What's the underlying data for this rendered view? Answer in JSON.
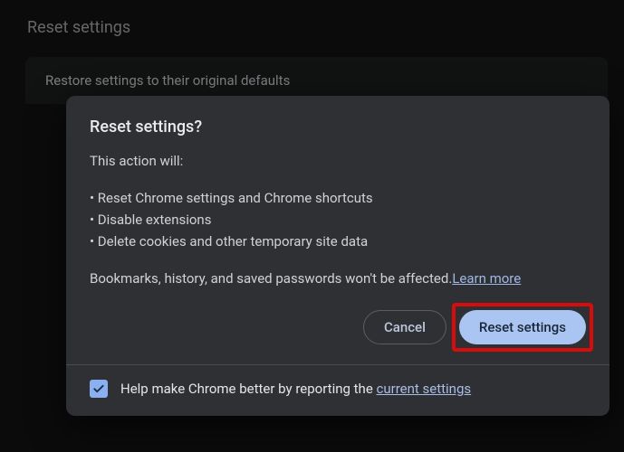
{
  "page": {
    "title": "Reset settings",
    "row_label": "Restore settings to their original defaults"
  },
  "dialog": {
    "title": "Reset settings?",
    "intro": "This action will:",
    "bullets": [
      "Reset Chrome settings and Chrome shortcuts",
      "Disable extensions",
      "Delete cookies and other temporary site data"
    ],
    "note_前": "Bookmarks, history, and saved passwords won't be affected.",
    "learn_more": "Learn more",
    "cancel_label": "Cancel",
    "confirm_label": "Reset settings",
    "footer_prefix": "Help make Chrome better by reporting the ",
    "footer_link": "current settings",
    "checkbox_checked": true
  },
  "colors": {
    "highlight": "#d90c0c",
    "primary_button_bg": "#aac5f2",
    "primary_button_fg": "#1b2636"
  }
}
